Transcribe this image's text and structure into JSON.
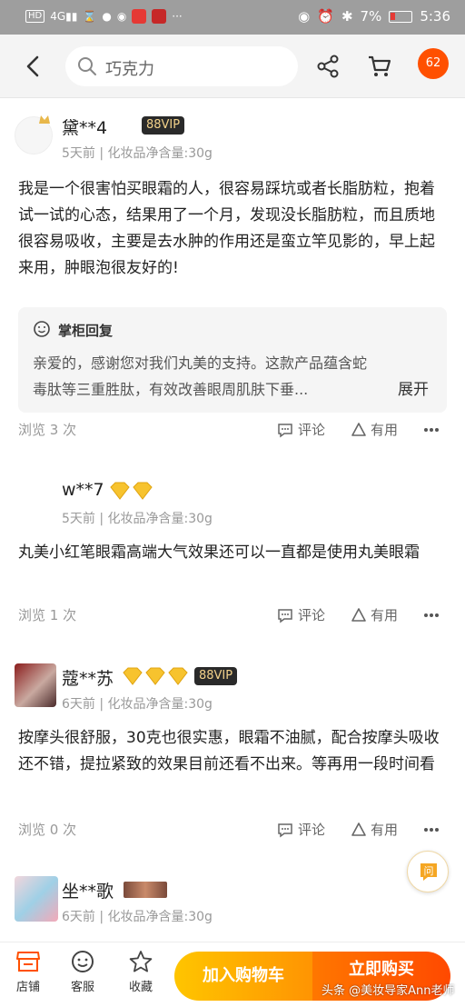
{
  "status_bar": {
    "left_icons": [
      "HD",
      "4G",
      "hourglass-icon",
      "wechat-icon",
      "app-icon",
      "app-icon",
      "..."
    ],
    "battery": "7%",
    "time": "5:36"
  },
  "header": {
    "search_placeholder": "巧克力",
    "badge": "62"
  },
  "reviews": [
    {
      "nickname": "黛**4",
      "vip": "88VIP",
      "meta": "5天前 | 化妆品净含量:30g",
      "body": "我是一个很害怕买眼霜的人，很容易踩坑或者长脂肪粒，抱着试一试的心态，结果用了一个月，发现没长脂肪粒，而且质地很容易吸收，主要是去水肿的作用还是蛮立竿见影的，早上起来用，肿眼泡很友好的!",
      "reply_title": "掌柜回复",
      "reply_text": "亲爱的，感谢您对我们丸美的支持。这款产品蕴含蛇毒肽等三重胜肽，有效改善眼周肌肤下垂...",
      "reply_expand": "展开",
      "views": "浏览 3 次",
      "comment": "评论",
      "useful": "有用"
    },
    {
      "nickname": "w**7",
      "meta": "5天前 | 化妆品净含量:30g",
      "body": "丸美小红笔眼霜高端大气效果还可以一直都是使用丸美眼霜",
      "views": "浏览 1 次",
      "comment": "评论",
      "useful": "有用"
    },
    {
      "nickname": "蔻**苏",
      "vip": "88VIP",
      "meta": "6天前 | 化妆品净含量:30g",
      "body": "按摩头很舒服，30克也很实惠，眼霜不油腻，配合按摩头吸收还不错，提拉紧致的效果目前还看不出来。等再用一段时间看",
      "views": "浏览 0 次",
      "comment": "评论",
      "useful": "有用"
    },
    {
      "nickname": "坐**歌",
      "meta": "6天前 | 化妆品净含量:30g"
    }
  ],
  "bottom_bar": {
    "store": "店铺",
    "service": "客服",
    "favorite": "收藏",
    "add_to_cart": "加入购物车",
    "buy_now": "立即购买"
  },
  "watermark": "头条 @美妆导家Ann老师",
  "colors": {
    "accent_orange": "#ff5000",
    "cart_yellow": "#ffc500",
    "buy_orange": "#ff4900",
    "vip_bg": "#2a2a2a",
    "vip_text": "#f3d28a"
  }
}
